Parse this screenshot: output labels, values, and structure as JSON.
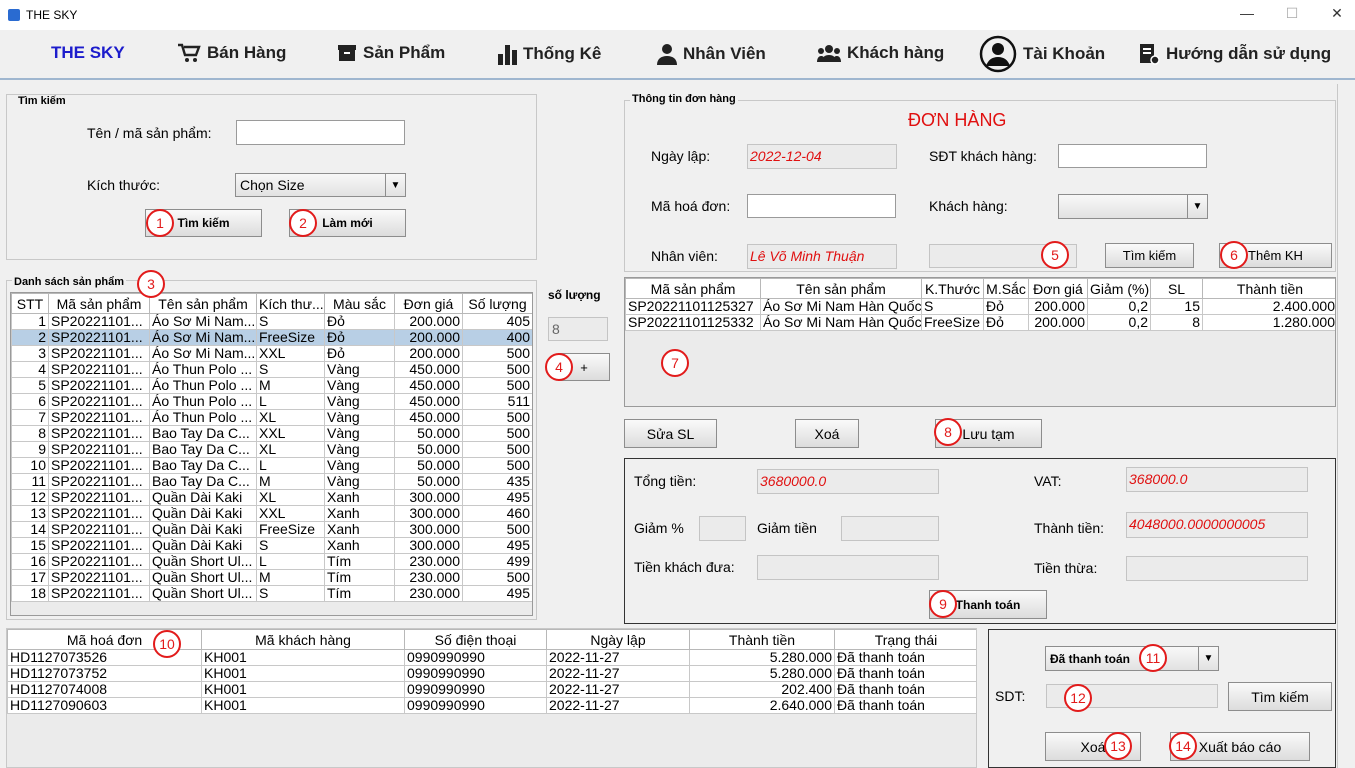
{
  "window": {
    "title": "THE SKY",
    "minimize": "—",
    "maximize": "☐",
    "close": "✕"
  },
  "nav": {
    "brand": "THE SKY",
    "items": [
      {
        "label": "Bán Hàng",
        "icon": "cart-icon"
      },
      {
        "label": "Sản Phẩm",
        "icon": "box-icon"
      },
      {
        "label": "Thống Kê",
        "icon": "bar-chart-icon"
      },
      {
        "label": "Nhân Viên",
        "icon": "person-icon"
      },
      {
        "label": "Khách hàng",
        "icon": "group-icon"
      },
      {
        "label": "Tài Khoản",
        "icon": "account-circle-icon"
      },
      {
        "label": "Hướng dẫn sử dụng",
        "icon": "manual-icon"
      }
    ]
  },
  "search_panel": {
    "legend": "Tìm kiếm",
    "name_label": "Tên / mã sản phẩm:",
    "name_value": "",
    "size_label": "Kích thước:",
    "size_selected": "Chọn Size",
    "search_button": "Tìm kiếm",
    "reset_button": "Làm mới"
  },
  "product_list": {
    "legend": "Danh sách sản phẩm",
    "columns": [
      "STT",
      "Mã sản phẩm",
      "Tên sản phẩm",
      "Kích thư...",
      "Màu sắc",
      "Đơn giá",
      "Số lượng"
    ],
    "selected_row": 1,
    "rows": [
      [
        "1",
        "SP20221101...",
        "Áo Sơ Mi Nam...",
        "S",
        "Đỏ",
        "200.000",
        "405"
      ],
      [
        "2",
        "SP20221101...",
        "Áo Sơ Mi Nam...",
        "FreeSize",
        "Đỏ",
        "200.000",
        "400"
      ],
      [
        "3",
        "SP20221101...",
        "Áo Sơ Mi Nam...",
        "XXL",
        "Đỏ",
        "200.000",
        "500"
      ],
      [
        "4",
        "SP20221101...",
        "Áo Thun Polo ...",
        "S",
        "Vàng",
        "450.000",
        "500"
      ],
      [
        "5",
        "SP20221101...",
        "Áo Thun Polo ...",
        "M",
        "Vàng",
        "450.000",
        "500"
      ],
      [
        "6",
        "SP20221101...",
        "Áo Thun Polo ...",
        "L",
        "Vàng",
        "450.000",
        "511"
      ],
      [
        "7",
        "SP20221101...",
        "Áo Thun Polo ...",
        "XL",
        "Vàng",
        "450.000",
        "500"
      ],
      [
        "8",
        "SP20221101...",
        "Bao Tay Da C...",
        "XXL",
        "Vàng",
        "50.000",
        "500"
      ],
      [
        "9",
        "SP20221101...",
        "Bao Tay Da C...",
        "XL",
        "Vàng",
        "50.000",
        "500"
      ],
      [
        "10",
        "SP20221101...",
        "Bao Tay Da C...",
        "L",
        "Vàng",
        "50.000",
        "500"
      ],
      [
        "11",
        "SP20221101...",
        "Bao Tay Da C...",
        "M",
        "Vàng",
        "50.000",
        "435"
      ],
      [
        "12",
        "SP20221101...",
        "Quần Dài Kaki",
        "XL",
        "Xanh",
        "300.000",
        "495"
      ],
      [
        "13",
        "SP20221101...",
        "Quần Dài Kaki",
        "XXL",
        "Xanh",
        "300.000",
        "460"
      ],
      [
        "14",
        "SP20221101...",
        "Quần Dài Kaki",
        "FreeSize",
        "Xanh",
        "300.000",
        "500"
      ],
      [
        "15",
        "SP20221101...",
        "Quần Dài Kaki",
        "S",
        "Xanh",
        "300.000",
        "495"
      ],
      [
        "16",
        "SP20221101...",
        "Quần Short Ul...",
        "L",
        "Tím",
        "230.000",
        "499"
      ],
      [
        "17",
        "SP20221101...",
        "Quần Short Ul...",
        "M",
        "Tím",
        "230.000",
        "500"
      ],
      [
        "18",
        "SP20221101...",
        "Quần Short Ul...",
        "S",
        "Tím",
        "230.000",
        "495"
      ]
    ]
  },
  "quantity": {
    "label": "số lượng",
    "value": "8",
    "add_button": "+"
  },
  "order_info": {
    "legend": "Thông tin đơn hàng",
    "heading": "ĐƠN HÀNG",
    "date_label": "Ngày lập:",
    "date_value": "2022-12-04",
    "phone_label": "SĐT khách hàng:",
    "phone_value": "",
    "invoice_label": "Mã hoá đơn:",
    "invoice_value": "",
    "customer_label": "Khách hàng:",
    "customer_selected": "",
    "staff_label": "Nhân viên:",
    "staff_value": "Lê Võ Minh Thuận",
    "customer_search_value": "",
    "search_button": "Tìm kiếm",
    "add_customer_button": "Thêm KH"
  },
  "cart": {
    "columns": [
      "Mã sản phẩm",
      "Tên sản phẩm",
      "K.Thước",
      "M.Sắc",
      "Đơn giá",
      "Giảm (%)",
      "SL",
      "Thành tiền"
    ],
    "rows": [
      [
        "SP20221101125327",
        "Áo Sơ Mi Nam Hàn Quốc",
        "S",
        "Đỏ",
        "200.000",
        "0,2",
        "15",
        "2.400.000"
      ],
      [
        "SP20221101125332",
        "Áo Sơ Mi Nam Hàn Quốc",
        "FreeSize",
        "Đỏ",
        "200.000",
        "0,2",
        "8",
        "1.280.000"
      ]
    ],
    "edit_qty_button": "Sửa SL",
    "delete_button": "Xoá",
    "save_draft_button": "Lưu tạm"
  },
  "payment": {
    "total_label": "Tổng tiền:",
    "total_value": "3680000.0",
    "vat_label": "VAT:",
    "vat_value": "368000.0",
    "discount_pct_label": "Giảm %",
    "discount_pct_value": "",
    "discount_amt_label": "Giảm tiền",
    "discount_amt_value": "",
    "grand_label": "Thành tiền:",
    "grand_value": "4048000.0000000005",
    "given_label": "Tiền khách đưa:",
    "given_value": "",
    "change_label": "Tiền thừa:",
    "change_value": "",
    "pay_button": "Thanh toán"
  },
  "invoices": {
    "columns": [
      "Mã hoá đơn",
      "Mã khách hàng",
      "Số điện thoại",
      "Ngày lập",
      "Thành tiền",
      "Trạng thái"
    ],
    "rows": [
      [
        "HD1127073526",
        "KH001",
        "0990990990",
        "2022-11-27",
        "5.280.000",
        "Đã thanh toán"
      ],
      [
        "HD1127073752",
        "KH001",
        "0990990990",
        "2022-11-27",
        "5.280.000",
        "Đã thanh toán"
      ],
      [
        "HD1127074008",
        "KH001",
        "0990990990",
        "2022-11-27",
        "202.400",
        "Đã thanh toán"
      ],
      [
        "HD1127090603",
        "KH001",
        "0990990990",
        "2022-11-27",
        "2.640.000",
        "Đã thanh toán"
      ]
    ]
  },
  "invoice_filter": {
    "status_selected": "Đã thanh toán",
    "phone_label": "SDT:",
    "phone_value": "",
    "search_button": "Tìm kiếm",
    "delete_button": "Xoá",
    "export_button": "Xuất báo cáo"
  },
  "badges": [
    "1",
    "2",
    "3",
    "4",
    "5",
    "6",
    "7",
    "8",
    "9",
    "10",
    "11",
    "12",
    "13",
    "14"
  ],
  "colors": {
    "accent_red": "#e01010",
    "brand_blue": "#1c1ccc",
    "selection": "#b8cfe5",
    "badge": "#e21b1b"
  }
}
